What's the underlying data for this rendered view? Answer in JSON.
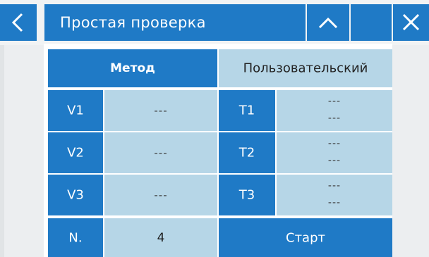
{
  "header": {
    "title": "Простая проверка",
    "back_icon": "chevron-left-icon",
    "up_icon": "chevron-up-icon",
    "close_icon": "close-icon"
  },
  "tabs": {
    "method_label": "Метод",
    "user_label": "Пользовательский"
  },
  "rows": [
    {
      "v_label": "V1",
      "v_value": "---",
      "t_label": "T1",
      "t_value_top": "---",
      "t_value_bottom": "---"
    },
    {
      "v_label": "V2",
      "v_value": "---",
      "t_label": "T2",
      "t_value_top": "---",
      "t_value_bottom": "---"
    },
    {
      "v_label": "V3",
      "v_value": "---",
      "t_label": "T3",
      "t_value_top": "---",
      "t_value_bottom": "---"
    }
  ],
  "footer": {
    "n_label": "N.",
    "n_value": "4",
    "start_label": "Старт"
  },
  "colors": {
    "accent": "#1f7ac6",
    "light_cell": "#b6d6e7",
    "background": "#eceef0"
  }
}
